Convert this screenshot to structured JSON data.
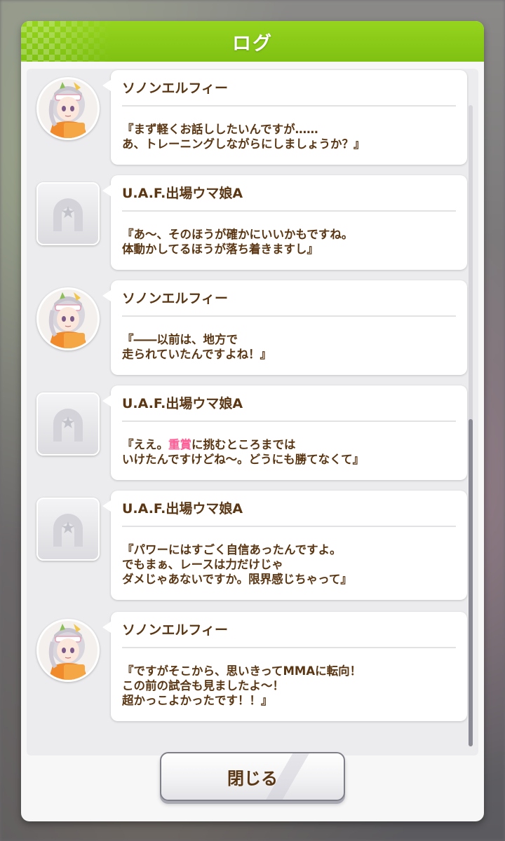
{
  "dialog": {
    "title": "ログ",
    "close_label": "閉じる"
  },
  "entries": [
    {
      "speaker": "ソノンエルフィー",
      "avatar": "character-portrait",
      "lines": [
        "『まず軽くお話ししたいんですが……",
        "あ、トレーニングしながらにしましょうか？』"
      ]
    },
    {
      "speaker": "U.A.F.出場ウマ娘A",
      "avatar": "horseshoe-placeholder",
      "lines": [
        "『あ～、そのほうが確かにいいかもですね。",
        "体動かしてるほうが落ち着きますし』"
      ]
    },
    {
      "speaker": "ソノンエルフィー",
      "avatar": "character-portrait",
      "lines": [
        "『――以前は、地方で",
        "走られていたんですよね！』"
      ]
    },
    {
      "speaker": "U.A.F.出場ウマ娘A",
      "avatar": "horseshoe-placeholder",
      "line1_prefix": "『ええ。",
      "line1_highlight": "重賞",
      "line1_suffix": "に挑むところまでは",
      "line2": "いけたんですけどね～。どうにも勝てなくて』"
    },
    {
      "speaker": "U.A.F.出場ウマ娘A",
      "avatar": "horseshoe-placeholder",
      "lines": [
        "『パワーにはすごく自信あったんですよ。",
        "でもまぁ、レースは力だけじゃ",
        "ダメじゃあないですか。限界感じちゃって』"
      ]
    },
    {
      "speaker": "ソノンエルフィー",
      "avatar": "character-portrait",
      "lines": [
        "『ですがそこから、思いきってMMAに転向！",
        "この前の試合も見ましたよ～！",
        "超かっこよかったです！！』"
      ]
    }
  ],
  "colors": {
    "header_green": "#8ccc16",
    "text_brown": "#5b3612",
    "highlight_pink": "#ff5c95"
  }
}
